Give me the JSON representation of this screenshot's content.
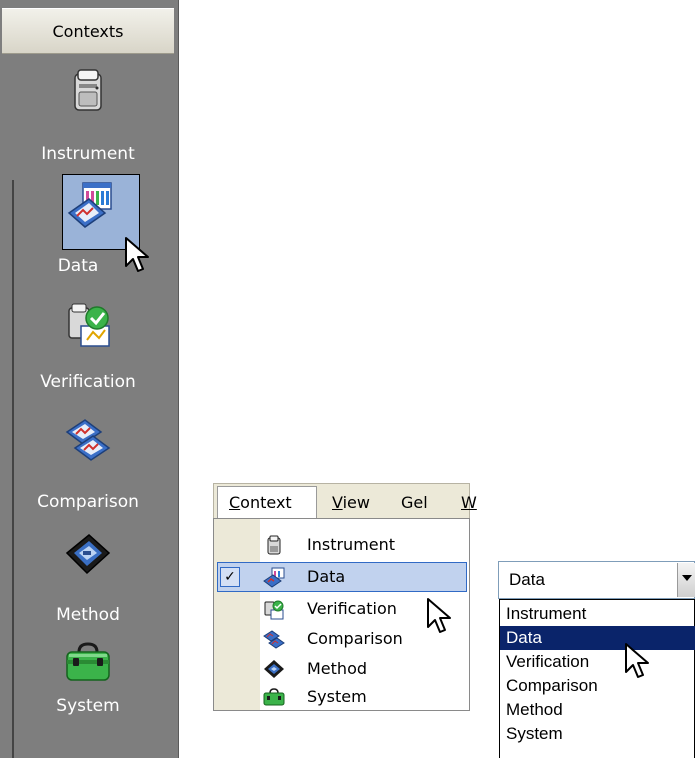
{
  "contexts_panel": {
    "header": "Contexts",
    "items": [
      {
        "label": "Instrument",
        "icon": "instrument-icon"
      },
      {
        "label": "Data",
        "icon": "data-icon",
        "selected": true
      },
      {
        "label": "Verification",
        "icon": "verification-icon"
      },
      {
        "label": "Comparison",
        "icon": "comparison-icon"
      },
      {
        "label": "Method",
        "icon": "method-icon"
      },
      {
        "label": "System",
        "icon": "system-icon"
      }
    ]
  },
  "menubar": {
    "items": [
      {
        "label": "Context",
        "accel": "C",
        "rest": "ontext",
        "active": true
      },
      {
        "label": "View",
        "accel": "V",
        "rest": "iew"
      },
      {
        "label": "Gel",
        "accel": "",
        "rest": "Gel"
      },
      {
        "label": "W",
        "accel": "W",
        "rest": ""
      }
    ],
    "dropdown": [
      {
        "label": "Instrument",
        "icon": "instrument-icon"
      },
      {
        "label": "Data",
        "icon": "data-icon",
        "checked": true,
        "highlighted": true
      },
      {
        "label": "Verification",
        "icon": "verification-icon"
      },
      {
        "label": "Comparison",
        "icon": "comparison-icon"
      },
      {
        "label": "Method",
        "icon": "method-icon"
      },
      {
        "label": "System",
        "icon": "system-icon"
      }
    ],
    "check_glyph": "✓"
  },
  "combo": {
    "value": "Data",
    "options": [
      "Instrument",
      "Data",
      "Verification",
      "Comparison",
      "Method",
      "System"
    ],
    "selected_index": 1
  },
  "colors": {
    "panel_bg": "#7e7e7e",
    "menu_highlight": "#c1d2ee",
    "list_selection": "#0a246a"
  }
}
